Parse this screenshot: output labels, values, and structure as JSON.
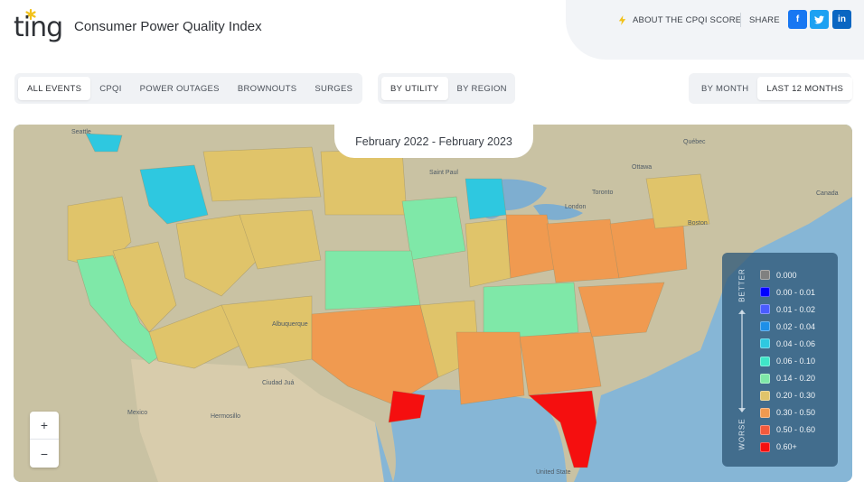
{
  "app": {
    "logo_text": "ting",
    "title": "Consumer Power Quality Index"
  },
  "header": {
    "about_label": "ABOUT THE CPQI SCORE",
    "share_label": "SHARE",
    "social": [
      {
        "name": "facebook",
        "glyph": "f",
        "color": "#1877f2"
      },
      {
        "name": "twitter",
        "glyph": "t",
        "color": "#1da1f2"
      },
      {
        "name": "linkedin",
        "glyph": "in",
        "color": "#0a66c2"
      }
    ]
  },
  "filters": {
    "event_types": [
      {
        "label": "ALL EVENTS",
        "active": true
      },
      {
        "label": "CPQI",
        "active": false
      },
      {
        "label": "POWER OUTAGES",
        "active": false
      },
      {
        "label": "BROWNOUTS",
        "active": false
      },
      {
        "label": "SURGES",
        "active": false
      }
    ],
    "grouping": [
      {
        "label": "BY UTILITY",
        "active": true
      },
      {
        "label": "BY REGION",
        "active": false
      }
    ],
    "period": [
      {
        "label": "BY MONTH",
        "active": false
      },
      {
        "label": "LAST 12 MONTHS",
        "active": true
      }
    ]
  },
  "map": {
    "date_range": "February 2022 - February 2023",
    "zoom_in": "+",
    "zoom_out": "−",
    "labels": {
      "seattle": "Seattle",
      "mexico": "Mexico",
      "united_states": "United State",
      "albuquerque": "Albuquerque",
      "ciudad_juarez": "Ciudad Juá",
      "hermosillo": "Hermosillo",
      "saint_paul": "Saint Paul",
      "ottawa": "Ottawa",
      "quebec": "Québec",
      "toronto": "Toronto",
      "london": "London",
      "boston": "Boston",
      "canada": "Canada"
    }
  },
  "legend": {
    "better": "BETTER",
    "worse": "WORSE",
    "items": [
      {
        "label": "0.000",
        "color": "#808080"
      },
      {
        "label": "0.00 - 0.01",
        "color": "#0000ff"
      },
      {
        "label": "0.01 - 0.02",
        "color": "#4a5cff"
      },
      {
        "label": "0.02 - 0.04",
        "color": "#1e8fe8"
      },
      {
        "label": "0.04 - 0.06",
        "color": "#2ec8e0"
      },
      {
        "label": "0.06 - 0.10",
        "color": "#3fe6c8"
      },
      {
        "label": "0.14 - 0.20",
        "color": "#7fe8a8"
      },
      {
        "label": "0.20 - 0.30",
        "color": "#e0c46a"
      },
      {
        "label": "0.30 - 0.50",
        "color": "#f09a50"
      },
      {
        "label": "0.50 - 0.60",
        "color": "#f25a3c"
      },
      {
        "label": "0.60+",
        "color": "#f50f0f"
      }
    ]
  }
}
